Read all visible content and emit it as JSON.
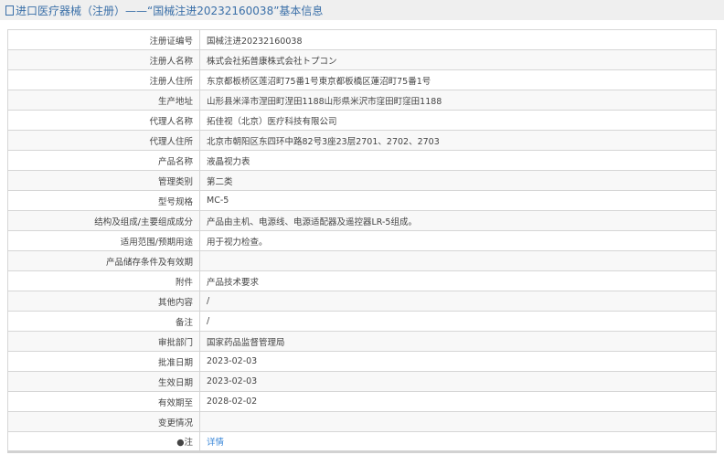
{
  "header": {
    "title": "进口医疗器械（注册）——“国械注进20232160038”基本信息"
  },
  "rows": [
    {
      "label": "注册证编号",
      "value": "国械注进20232160038"
    },
    {
      "label": "注册人名称",
      "value": "株式会社拓普康株式会社トプコン"
    },
    {
      "label": "注册人住所",
      "value": "东京都板桥区莲沼町75番1号東京都板橋区蓮沼町75番1号"
    },
    {
      "label": "生产地址",
      "value": "山形县米泽市涅田町涅田1188山形県米沢市窪田町窪田1188"
    },
    {
      "label": "代理人名称",
      "value": "拓佳视（北京）医疗科技有限公司"
    },
    {
      "label": "代理人住所",
      "value": "北京市朝阳区东四环中路82号3座23层2701、2702、2703"
    },
    {
      "label": "产品名称",
      "value": "液晶视力表"
    },
    {
      "label": "管理类别",
      "value": "第二类"
    },
    {
      "label": "型号规格",
      "value": "MC-5"
    },
    {
      "label": "结构及组成/主要组成成分",
      "value": "产品由主机、电源线、电源适配器及遥控器LR-5组成。"
    },
    {
      "label": "适用范围/预期用途",
      "value": "用于视力检查。"
    },
    {
      "label": "产品储存条件及有效期",
      "value": ""
    },
    {
      "label": "附件",
      "value": "产品技术要求"
    },
    {
      "label": "其他内容",
      "value": "/"
    },
    {
      "label": "备注",
      "value": "/"
    },
    {
      "label": "审批部门",
      "value": "国家药品监督管理局"
    },
    {
      "label": "批准日期",
      "value": "2023-02-03"
    },
    {
      "label": "生效日期",
      "value": "2023-02-03"
    },
    {
      "label": "有效期至",
      "value": "2028-02-02"
    },
    {
      "label": "变更情况",
      "value": ""
    },
    {
      "label": "●注",
      "value": "详情",
      "link": true
    }
  ]
}
